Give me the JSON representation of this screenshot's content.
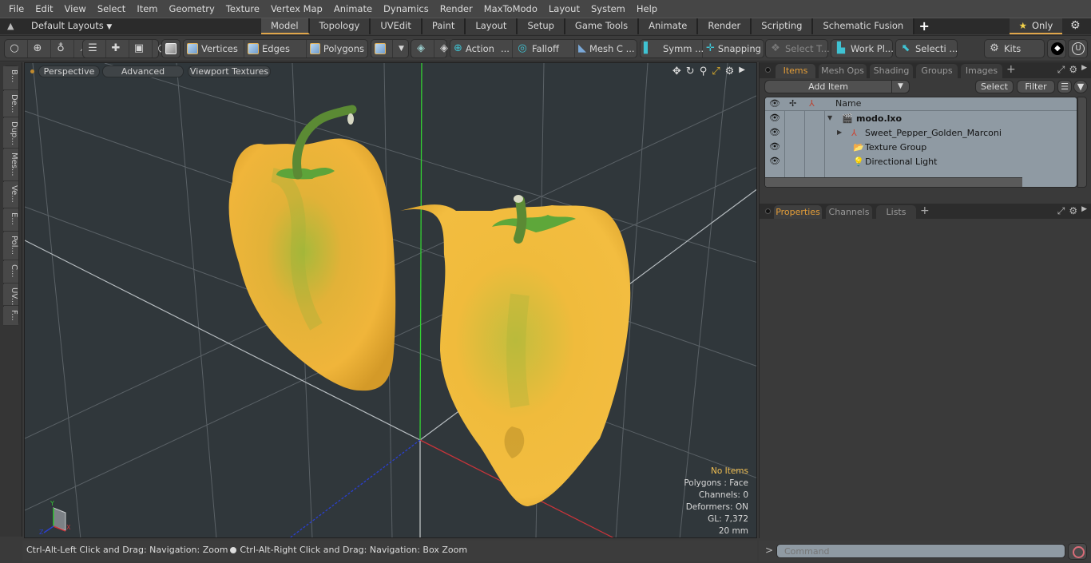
{
  "menubar": {
    "items": [
      "File",
      "Edit",
      "View",
      "Select",
      "Item",
      "Geometry",
      "Texture",
      "Vertex Map",
      "Animate",
      "Dynamics",
      "Render",
      "MaxToModo",
      "Layout",
      "System",
      "Help"
    ]
  },
  "layoutbar": {
    "layouts_label": "Default Layouts",
    "tabs": [
      "Model",
      "Topology",
      "UVEdit",
      "Paint",
      "Layout",
      "Setup",
      "Game Tools",
      "Animate",
      "Render",
      "Scripting",
      "Schematic Fusion"
    ],
    "active_tab": "Model",
    "add_tab": "+",
    "only_label": "Only"
  },
  "toolbar": {
    "vertices": "Vertices",
    "edges": "Edges",
    "polygons": "Polygons",
    "action": "Action",
    "action_more": "...",
    "falloff": "Falloff",
    "mesh_c": "Mesh C ...",
    "symm": "Symm ...",
    "snapping": "Snapping",
    "select_t": "Select T...",
    "work_pl": "Work Pl...",
    "selecti": "Selecti ...",
    "kits": "Kits"
  },
  "leftstrip": {
    "tabs": [
      "B...",
      "De...",
      "Dup...",
      "Mes...",
      "Ve...",
      "E...",
      "Pol...",
      "C...",
      "UV...",
      "F..."
    ]
  },
  "viewport": {
    "perspective": "Perspective",
    "advanced": "Advanced",
    "viewport_textures": "Viewport Textures",
    "hud": {
      "selection": "No Items",
      "polygons": "Polygons : Face",
      "channels": "Channels: 0",
      "deformers": "Deformers: ON",
      "gl": "GL: 7,372",
      "unit": "20 mm"
    },
    "axis_labels": {
      "x": "X",
      "y": "Y",
      "z": "Z"
    }
  },
  "statusbar": {
    "hint_left": "Ctrl-Alt-Left Click and Drag: Navigation: Zoom",
    "hint_right": "Ctrl-Alt-Right Click and Drag: Navigation: Box Zoom"
  },
  "items_panel": {
    "tabs": [
      "Items",
      "Mesh Ops",
      "Shading",
      "Groups",
      "Images"
    ],
    "active_tab": "Items",
    "add_tab": "+",
    "add_item": "Add Item",
    "select": "Select",
    "filter": "Filter",
    "name_header": "Name",
    "rows": [
      {
        "name": "modo.lxo",
        "icon": "scene-icon",
        "depth": 0,
        "expander": "▼"
      },
      {
        "name": "Sweet_Pepper_Golden_Marconi",
        "icon": "mesh-locator-icon",
        "depth": 1,
        "expander": "▶"
      },
      {
        "name": "Texture Group",
        "icon": "folder-icon",
        "depth": 1,
        "expander": ""
      },
      {
        "name": "Directional Light",
        "icon": "light-icon",
        "depth": 1,
        "expander": ""
      }
    ]
  },
  "properties_panel": {
    "tabs": [
      "Properties",
      "Channels",
      "Lists"
    ],
    "active_tab": "Properties",
    "add_tab": "+"
  },
  "command": {
    "prompt": ">",
    "placeholder": "Command"
  },
  "colors": {
    "accent": "#e0a64a",
    "axis_x": "#c8343a",
    "axis_y": "#2ed42e",
    "axis_z": "#2a3fd0",
    "viewport_bg": "#30373b"
  }
}
